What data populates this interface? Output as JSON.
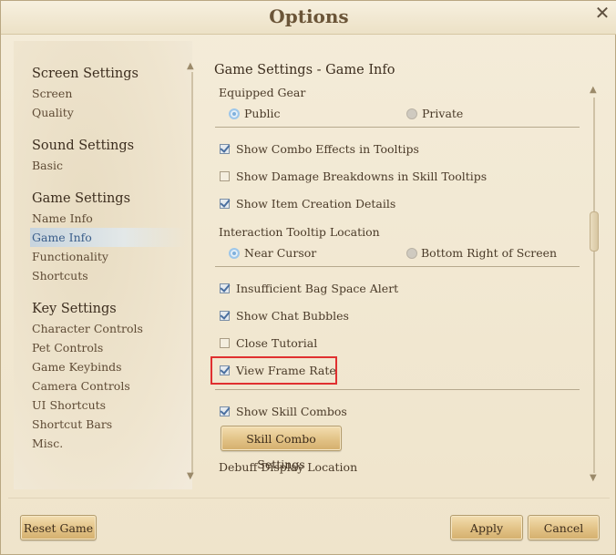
{
  "window": {
    "title": "Options"
  },
  "sidebar": {
    "sections": [
      {
        "heading": "Screen Settings",
        "items": [
          "Screen",
          "Quality"
        ]
      },
      {
        "heading": "Sound Settings",
        "items": [
          "Basic"
        ]
      },
      {
        "heading": "Game Settings",
        "items": [
          "Name Info",
          "Game Info",
          "Functionality",
          "Shortcuts"
        ]
      },
      {
        "heading": "Key Settings",
        "items": [
          "Character Controls",
          "Pet Controls",
          "Game Keybinds",
          "Camera Controls",
          "UI Shortcuts",
          "Shortcut Bars",
          "Misc."
        ]
      }
    ],
    "selected": "Game Info"
  },
  "content": {
    "title": "Game Settings - Game Info",
    "equipped_gear": {
      "label": "Equipped Gear",
      "option_public": "Public",
      "option_private": "Private",
      "selected": "Public"
    },
    "show_combo_effects": {
      "label": "Show Combo Effects in Tooltips",
      "checked": true
    },
    "show_damage_breakdowns": {
      "label": "Show Damage Breakdowns in Skill Tooltips",
      "checked": false
    },
    "show_item_creation": {
      "label": "Show Item Creation Details",
      "checked": true
    },
    "interaction_tooltip": {
      "label": "Interaction Tooltip Location",
      "option_near": "Near Cursor",
      "option_bottom": "Bottom Right of Screen",
      "selected": "Near Cursor"
    },
    "insufficient_bag": {
      "label": "Insufficient Bag Space Alert",
      "checked": true
    },
    "chat_bubbles": {
      "label": "Show Chat Bubbles",
      "checked": true
    },
    "close_tutorial": {
      "label": "Close Tutorial",
      "checked": false
    },
    "view_frame_rate": {
      "label": "View Frame Rate",
      "checked": true
    },
    "show_skill_combos": {
      "label": "Show Skill Combos",
      "checked": true
    },
    "skill_combo_button": "Skill Combo Settings",
    "debuff_display": {
      "label": "Debuff Display Location"
    }
  },
  "footer": {
    "reset_label": "Reset Game",
    "apply_label": "Apply",
    "cancel_label": "Cancel"
  },
  "colors": {
    "highlight": "#e03030",
    "selected_text": "#3a5d8a",
    "check": "#4a6fa0"
  },
  "icons": {
    "close": "close-icon",
    "scroll_up": "chevron-up-icon",
    "scroll_down": "chevron-down-icon"
  }
}
